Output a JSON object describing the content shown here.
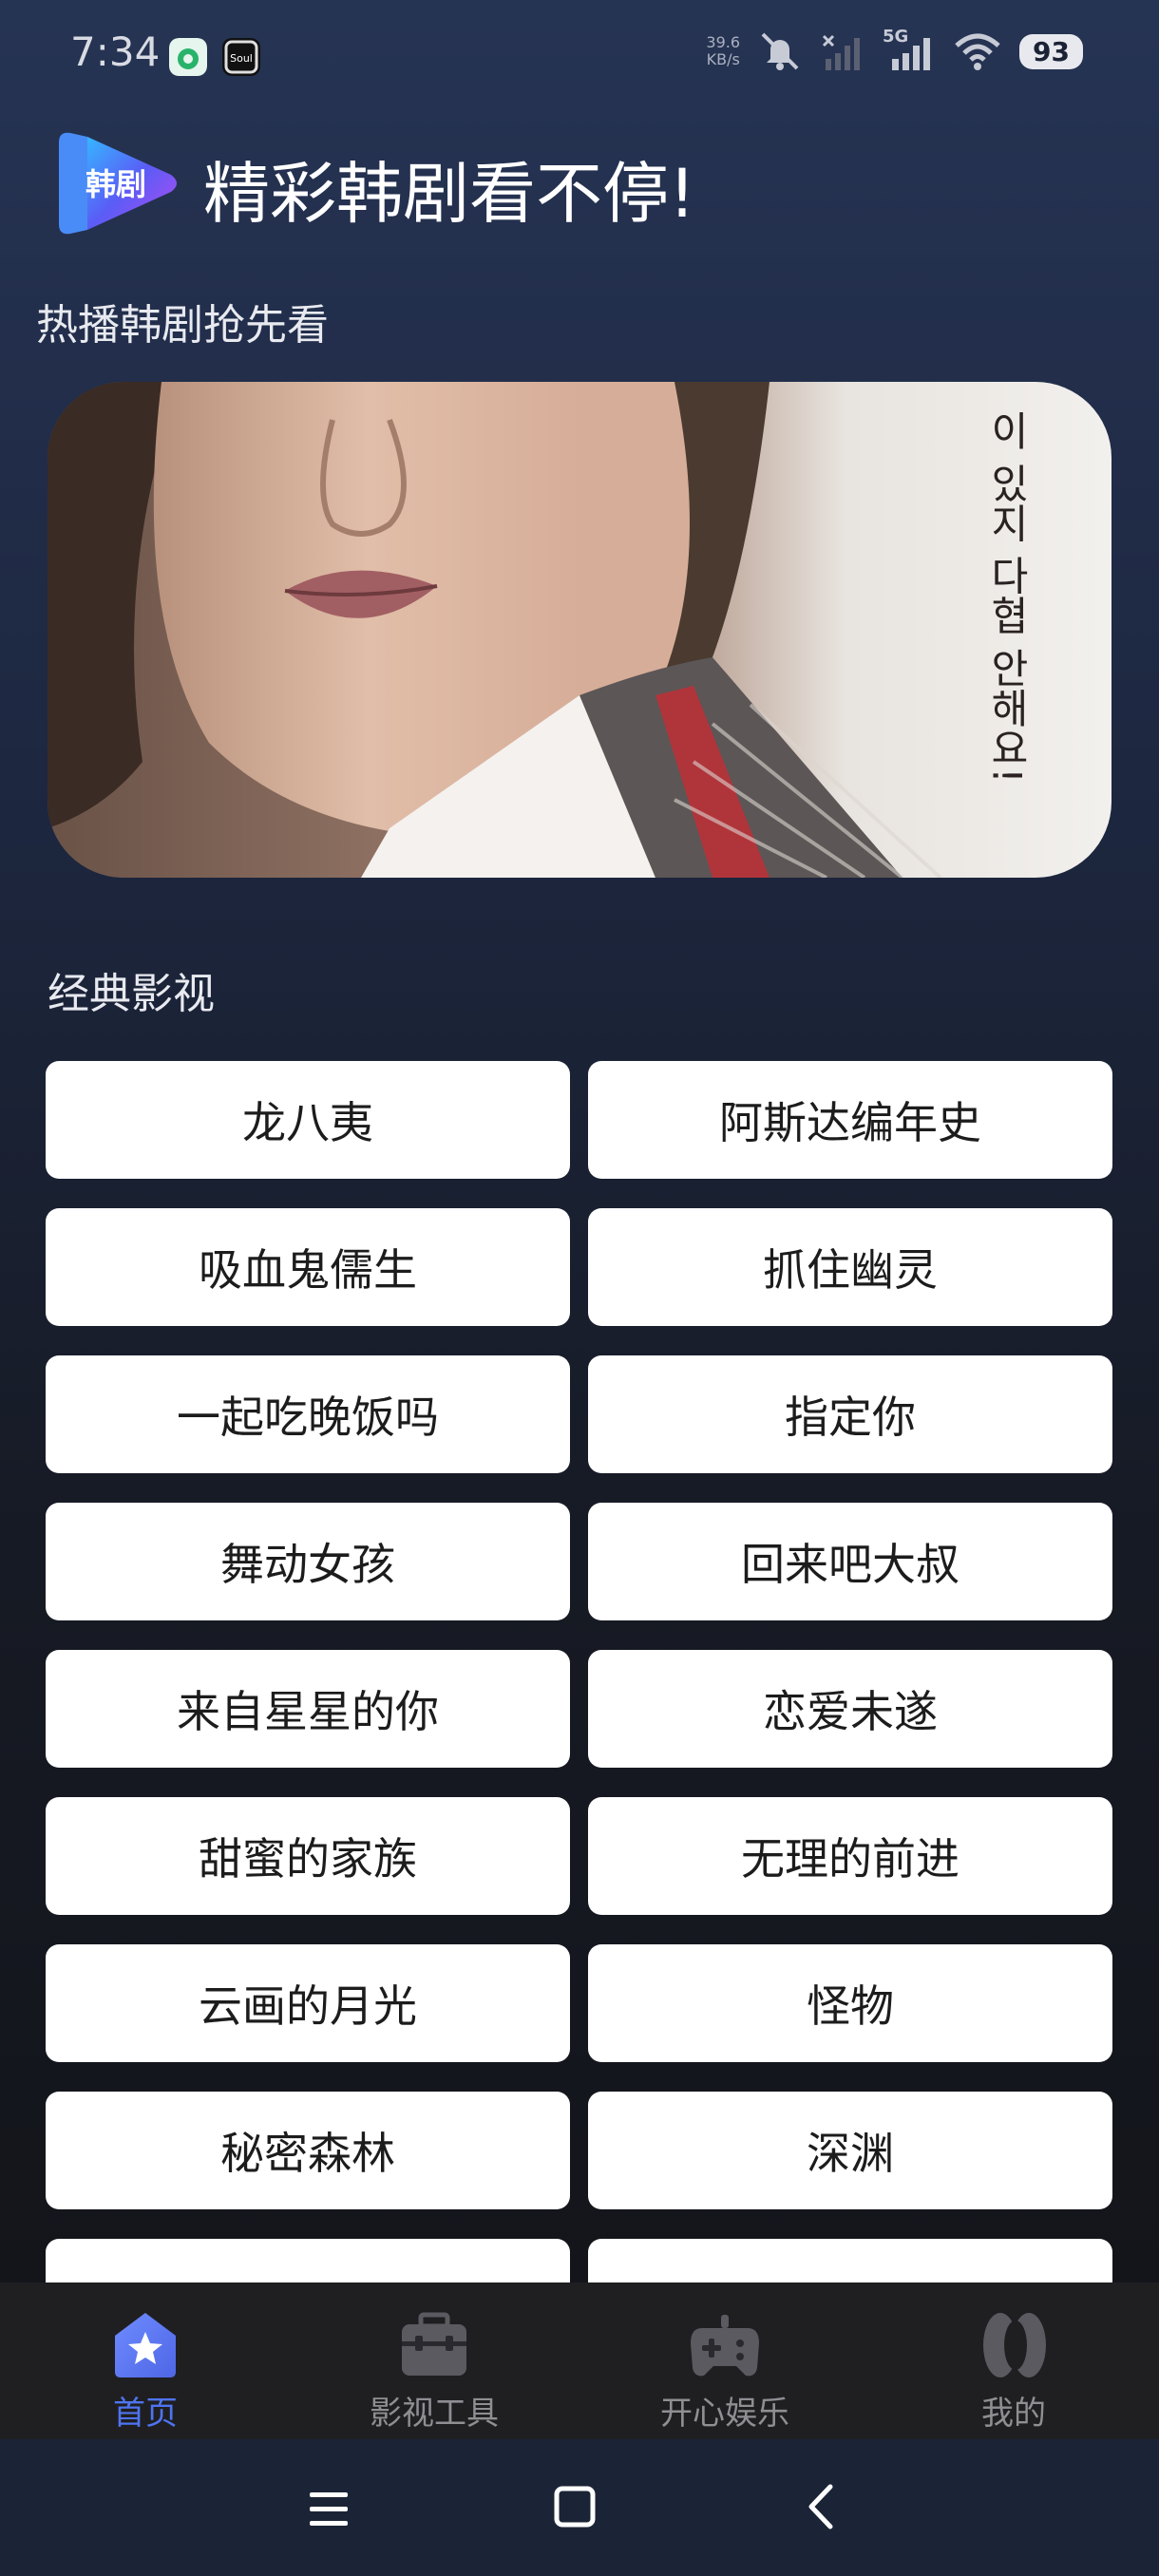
{
  "status_bar": {
    "time": "7:34",
    "net_speed_value": "39.6",
    "net_speed_unit": "KB/s",
    "network": "5G",
    "battery": "93",
    "icons": [
      "app-icon-green",
      "soul-app-icon",
      "mute-icon",
      "signal-icon",
      "signal-5g-icon",
      "wifi-icon",
      "battery-icon"
    ]
  },
  "header": {
    "logo_text": "韩剧",
    "title": "精彩韩剧看不停!"
  },
  "hot_section": {
    "title": "热播韩剧抢先看",
    "banner_text": "이 있지 다협 안해요!"
  },
  "classic_section": {
    "title": "经典影视",
    "items": [
      "龙八夷",
      "阿斯达编年史",
      "吸血鬼儒生",
      "抓住幽灵",
      "一起吃晚饭吗",
      "指定你",
      "舞动女孩",
      "回来吧大叔",
      "来自星星的你",
      "恋爱未遂",
      "甜蜜的家族",
      "无理的前进",
      "云画的月光",
      "怪物",
      "秘密森林",
      "深渊",
      "",
      ""
    ]
  },
  "bottom_nav": {
    "items": [
      {
        "label": "首页",
        "icon": "home-star-icon",
        "active": true
      },
      {
        "label": "影视工具",
        "icon": "toolbox-icon",
        "active": false
      },
      {
        "label": "开心娱乐",
        "icon": "gamepad-icon",
        "active": false
      },
      {
        "label": "我的",
        "icon": "profile-icon",
        "active": false
      }
    ]
  },
  "colors": {
    "accent": "#4f74f0",
    "background_top": "#263454",
    "background_bottom": "#121317",
    "button_bg": "#ffffff",
    "nav_bg": "#1f1f22"
  }
}
